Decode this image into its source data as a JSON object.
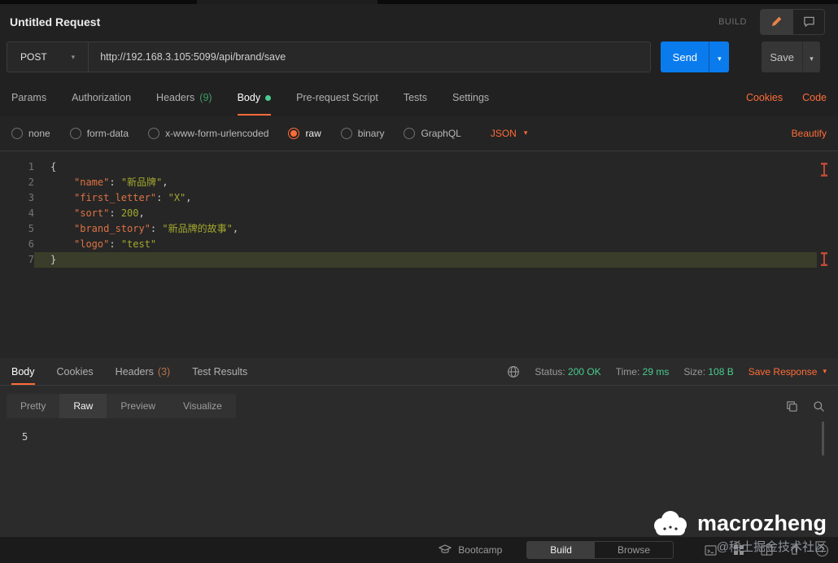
{
  "topbar": {
    "title": "Untitled Request",
    "build_label": "BUILD"
  },
  "request": {
    "method": "POST",
    "url": "http://192.168.3.105:5099/api/brand/save",
    "send_label": "Send",
    "save_label": "Save"
  },
  "tabs": {
    "params": "Params",
    "authorization": "Authorization",
    "headers": "Headers",
    "headers_count": "(9)",
    "body": "Body",
    "pre_request": "Pre-request Script",
    "tests": "Tests",
    "settings": "Settings",
    "cookies": "Cookies",
    "code": "Code"
  },
  "body_options": {
    "none": "none",
    "form_data": "form-data",
    "urlencoded": "x-www-form-urlencoded",
    "raw": "raw",
    "binary": "binary",
    "graphql": "GraphQL",
    "format": "JSON",
    "beautify": "Beautify"
  },
  "editor": {
    "lines": [
      {
        "num": "1",
        "open": "{"
      },
      {
        "num": "2",
        "key": "\"name\"",
        "sep": ": ",
        "val": "\"新品牌\"",
        "comma": ","
      },
      {
        "num": "3",
        "key": "\"first_letter\"",
        "sep": ": ",
        "val": "\"X\"",
        "comma": ","
      },
      {
        "num": "4",
        "key": "\"sort\"",
        "sep": ": ",
        "nval": "200",
        "comma": ","
      },
      {
        "num": "5",
        "key": "\"brand_story\"",
        "sep": ": ",
        "val": "\"新品牌的故事\"",
        "comma": ","
      },
      {
        "num": "6",
        "key": "\"logo\"",
        "sep": ": ",
        "val": "\"test\""
      },
      {
        "num": "7",
        "close": "}"
      }
    ]
  },
  "response": {
    "tab_body": "Body",
    "tab_cookies": "Cookies",
    "tab_headers": "Headers",
    "headers_count": "(3)",
    "tab_test_results": "Test Results",
    "status_label": "Status:",
    "status_value": "200 OK",
    "time_label": "Time:",
    "time_value": "29 ms",
    "size_label": "Size:",
    "size_value": "108 B",
    "save_response": "Save Response",
    "view_pretty": "Pretty",
    "view_raw": "Raw",
    "view_preview": "Preview",
    "view_visualize": "Visualize",
    "body_text": "5"
  },
  "footer": {
    "bootcamp": "Bootcamp",
    "build": "Build",
    "browse": "Browse"
  },
  "watermark": {
    "name": "macrozheng",
    "subtitle": "@稀土掘金技术社区"
  },
  "icons": {
    "caret_down": "▾",
    "help": "?"
  },
  "colors": {
    "accent_orange": "#ff6c37",
    "send_blue": "#097bed",
    "status_green": "#49cc90"
  }
}
